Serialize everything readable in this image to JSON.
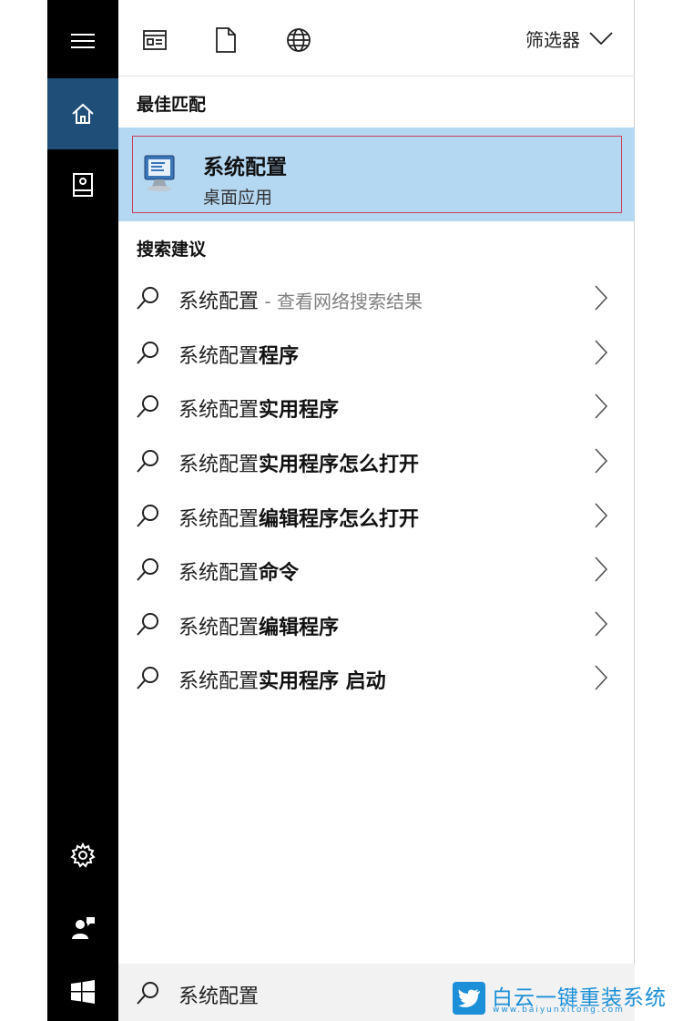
{
  "toolbar": {
    "filter_label": "筛选器",
    "icons": [
      "app-icon",
      "document-icon",
      "web-globe-icon",
      "chevron-down-icon"
    ]
  },
  "best_match": {
    "heading": "最佳匹配",
    "title": "系统配置",
    "subtitle": "桌面应用"
  },
  "suggestions": {
    "heading": "搜索建议",
    "items": [
      {
        "prefix": "系统配置",
        "bold": "",
        "hint": " - 查看网络搜索结果"
      },
      {
        "prefix": "系统配置",
        "bold": "程序",
        "hint": ""
      },
      {
        "prefix": "系统配置",
        "bold": "实用程序",
        "hint": ""
      },
      {
        "prefix": "系统配置",
        "bold": "实用程序怎么打开",
        "hint": ""
      },
      {
        "prefix": "系统配置",
        "bold": "编辑程序怎么打开",
        "hint": ""
      },
      {
        "prefix": "系统配置",
        "bold": "命令",
        "hint": ""
      },
      {
        "prefix": "系统配置",
        "bold": "编辑程序",
        "hint": ""
      },
      {
        "prefix": "系统配置",
        "bold": "实用程序 启动",
        "hint": ""
      }
    ]
  },
  "search": {
    "query": "系统配置"
  },
  "sidebar": {
    "icons": [
      "hamburger-menu-icon",
      "home-icon",
      "notebook-icon",
      "settings-gear-icon",
      "user-feedback-icon",
      "windows-start-icon"
    ]
  },
  "watermark": {
    "brand": "白云一键重装系统",
    "url": "www.baiyunxitong.com"
  },
  "colors": {
    "rail": "#000000",
    "rail_selected": "#1f4e79",
    "best_match_bg": "#b4d7f2",
    "selection_border": "#c9415c",
    "watermark": "#1b8fd8"
  }
}
